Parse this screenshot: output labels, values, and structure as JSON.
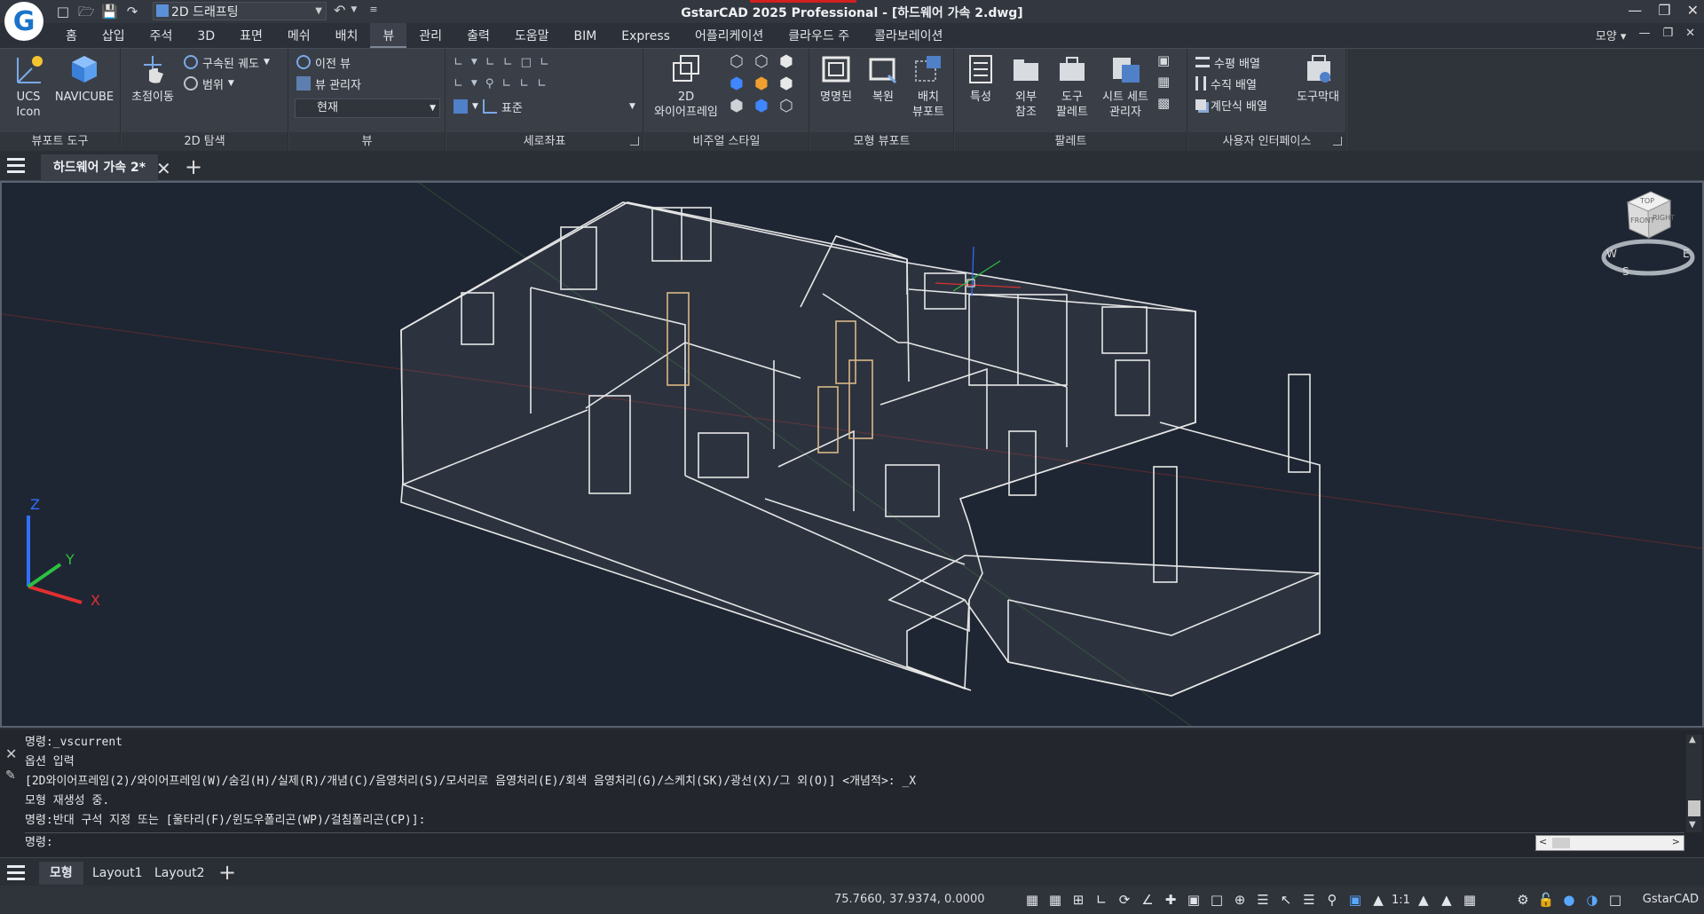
{
  "titlebar": {
    "workspace": "2D 드래프팅",
    "window_title": "GstarCAD 2025 Professional - [하드웨어 가속 2.dwg]",
    "logo_letter": "G"
  },
  "menu": {
    "items": [
      "홈",
      "삽입",
      "주석",
      "3D",
      "표면",
      "메쉬",
      "배치",
      "뷰",
      "관리",
      "출력",
      "도움말",
      "BIM",
      "Express",
      "어플리케이션",
      "클라우드 주",
      "콜라보레이션"
    ],
    "active_index": 7,
    "right_label": "모양"
  },
  "ribbon": {
    "viewport_tools": {
      "title": "뷰포트 도구",
      "ucs_label_1": "UCS",
      "ucs_label_2": "Icon",
      "navicube_label": "NAVICUBE"
    },
    "nav2d": {
      "title": "2D 탐색",
      "pan_label": "초점이동",
      "orbit_label": "구속된 궤도",
      "extents_label": "범위"
    },
    "views": {
      "title": "뷰",
      "prev_view": "이전 뷰",
      "view_manager": "뷰 관리자",
      "current": "현재"
    },
    "coordinates": {
      "title": "세로좌표",
      "standard": "표준"
    },
    "visual_styles": {
      "title": "비주얼 스타일",
      "wire_label_1": "2D",
      "wire_label_2": "와이어프레임"
    },
    "model_viewports": {
      "title": "모형 뷰포트",
      "named": "명명된",
      "restore": "복원",
      "layout_label_1": "배치",
      "layout_label_2": "뷰포트"
    },
    "palettes": {
      "title": "팔레트",
      "properties": "특성",
      "xref_1": "외부",
      "xref_2": "참조",
      "tool_1": "도구",
      "tool_2": "팔레트",
      "sheet_1": "시트 세트",
      "sheet_2": "관리자"
    },
    "ui": {
      "title": "사용자 인터페이스",
      "horiz": "수평 배열",
      "vert": "수직 배열",
      "cascade": "계단식 배열",
      "toolbar": "도구막대"
    }
  },
  "filetab": {
    "name": "하드웨어 가속 2*"
  },
  "viewcube": {
    "top": "TOP",
    "front": "FRONT",
    "right": "RIGHT",
    "compass_s": "S",
    "compass_w": "W",
    "compass_e": "E"
  },
  "ucs_axes": {
    "x": "X",
    "y": "Y",
    "z": "Z"
  },
  "command": {
    "history": [
      "명령:_vscurrent",
      "옵션 입력",
      "[2D와이어프레임(2)/와이어프레임(W)/숨김(H)/실제(R)/개념(C)/음영처리(S)/모서리로 음영처리(E)/회색 음영처리(G)/스케치(SK)/광선(X)/그 외(O)] <개념적>: _X",
      "모형 재생성 중.",
      "명령:반대 구석 지정 또는 [울타리(F)/윈도우폴리곤(WP)/걸침폴리곤(CP)]:"
    ],
    "prompt": "명령:"
  },
  "layouts": {
    "tabs": [
      "모형",
      "Layout1",
      "Layout2"
    ],
    "active_index": 0
  },
  "status": {
    "coords": "75.7660, 37.9374, 0.0000",
    "scale": "1:1",
    "brand": "GstarCAD"
  },
  "colors": {
    "viewport_bg": "#1f2633",
    "axis_x": "#e03030",
    "axis_y": "#2cc040",
    "axis_z": "#3070ff",
    "building_line": "#e8e8e8"
  }
}
